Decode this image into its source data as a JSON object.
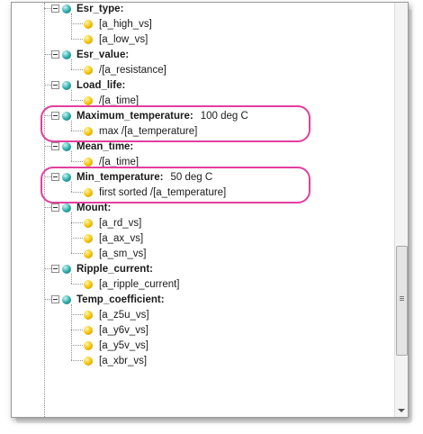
{
  "tree": {
    "nodes": [
      {
        "label": "Esr_type:",
        "value": "",
        "children": [
          "[a_high_vs]",
          "[a_low_vs]"
        ]
      },
      {
        "label": "Esr_value:",
        "value": "",
        "children": [
          "/[a_resistance]"
        ]
      },
      {
        "label": "Load_life:",
        "value": "",
        "children": [
          "/[a_time]"
        ]
      },
      {
        "label": "Maximum_temperature:",
        "value": "100 deg C",
        "children": [
          "max  /[a_temperature]"
        ]
      },
      {
        "label": "Mean_time:",
        "value": "",
        "children": [
          "/[a_time]"
        ]
      },
      {
        "label": "Min_temperature:",
        "value": "50 deg C",
        "children": [
          "first sorted  /[a_temperature]"
        ]
      },
      {
        "label": "Mount:",
        "value": "",
        "children": [
          "[a_rd_vs]",
          "[a_ax_vs]",
          "[a_sm_vs]"
        ]
      },
      {
        "label": "Ripple_current:",
        "value": "",
        "children": [
          "[a_ripple_current]"
        ]
      },
      {
        "label": "Temp_coefficient:",
        "value": "",
        "children": [
          "[a_z5u_vs]",
          "[a_y6v_vs]",
          "[a_y5v_vs]",
          "[a_xbr_vs]"
        ]
      }
    ]
  },
  "icons": {
    "node_icon": "teal-sphere-icon",
    "leaf_icon": "yellow-sphere-icon",
    "expander": "minus-box-icon"
  },
  "colors": {
    "highlight": "#e23f9f",
    "node_icon": "#2aa9a8",
    "leaf_icon": "#f2c200"
  }
}
